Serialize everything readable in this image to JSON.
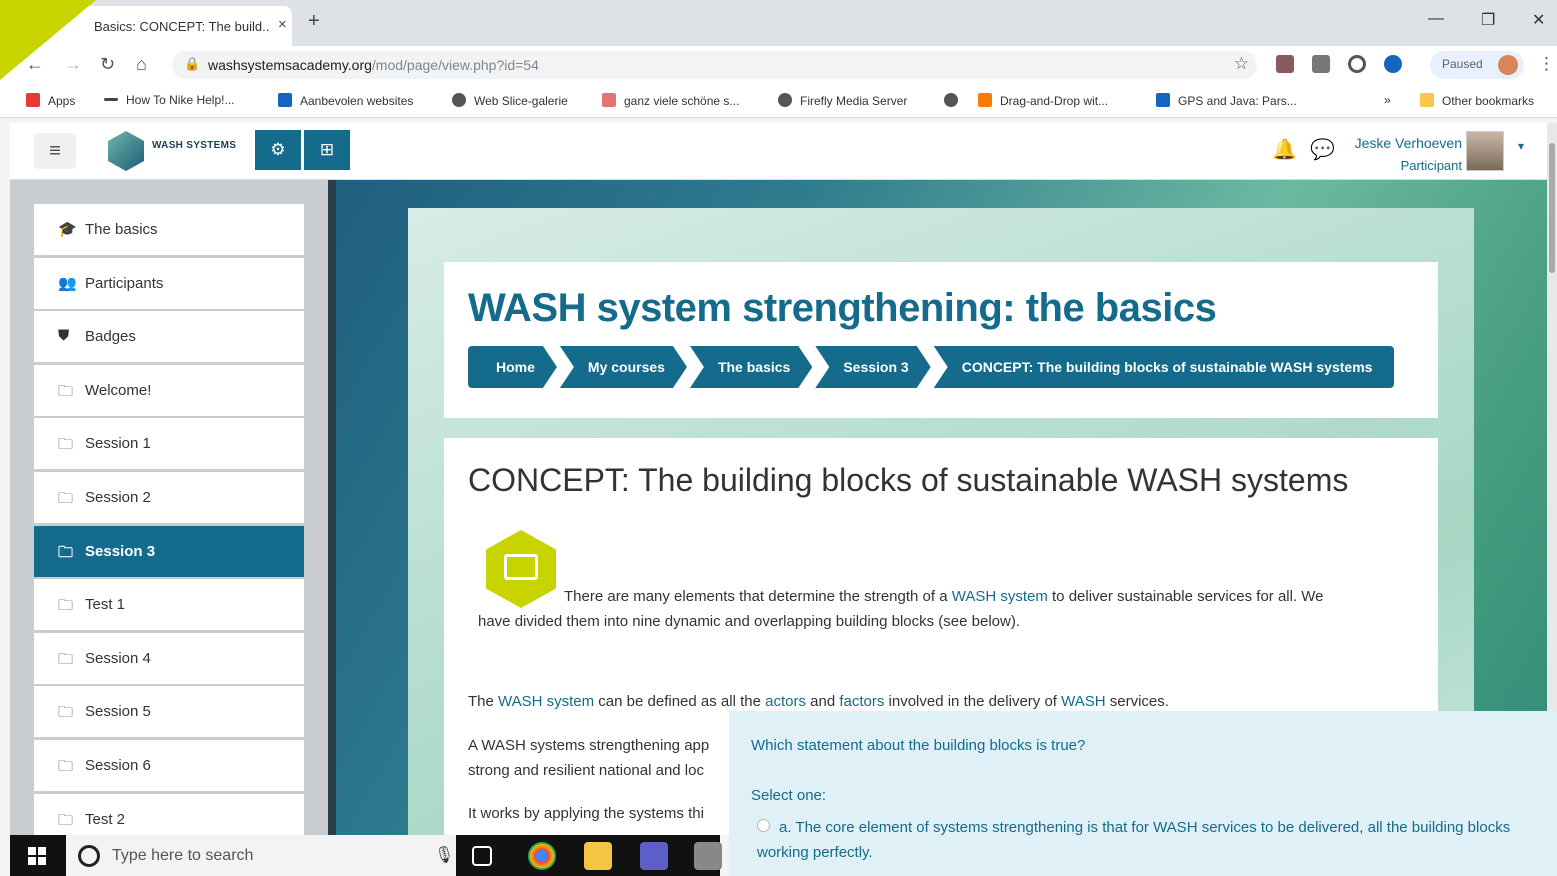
{
  "browser": {
    "tab_title": "Basics: CONCEPT: The build...",
    "tab_close": "×",
    "new_tab": "+",
    "url_host": "washsystemsacademy.org",
    "url_path": "/mod/page/view.php?id=54",
    "paused_label": "Paused",
    "bookmarks": [
      "Apps",
      "How To Nike Help!...",
      "Aanbevolen websites",
      "Web Slice-galerie",
      "ganz viele schöne s...",
      "Firefly Media Server",
      "Drag-and-Drop wit...",
      "GPS and Java: Pars...",
      "»",
      "Other bookmarks"
    ]
  },
  "header": {
    "logo_text": "WASH SYSTEMS",
    "user_name": "Jeske Verhoeven",
    "user_role": "Participant"
  },
  "sidebar": {
    "items": [
      {
        "icon": "graduation-cap-icon",
        "glyph": "🎓",
        "label": "The basics"
      },
      {
        "icon": "users-icon",
        "glyph": "👥",
        "label": "Participants"
      },
      {
        "icon": "shield-icon",
        "glyph": "⛊",
        "label": "Badges"
      },
      {
        "icon": "folder-icon",
        "glyph": "🗀",
        "label": "Welcome!"
      },
      {
        "icon": "folder-icon",
        "glyph": "🗀",
        "label": "Session 1"
      },
      {
        "icon": "folder-icon",
        "glyph": "🗀",
        "label": "Session 2"
      },
      {
        "icon": "folder-icon",
        "glyph": "🗀",
        "label": "Session 3",
        "active": true
      },
      {
        "icon": "folder-icon",
        "glyph": "🗀",
        "label": "Test 1"
      },
      {
        "icon": "folder-icon",
        "glyph": "🗀",
        "label": "Session 4"
      },
      {
        "icon": "folder-icon",
        "glyph": "🗀",
        "label": "Session 5"
      },
      {
        "icon": "folder-icon",
        "glyph": "🗀",
        "label": "Session 6"
      },
      {
        "icon": "folder-icon",
        "glyph": "🗀",
        "label": "Test 2"
      }
    ]
  },
  "main": {
    "page_title": "WASH system strengthening: the basics",
    "breadcrumbs": [
      "Home",
      "My courses",
      "The basics",
      "Session 3",
      "CONCEPT: The building blocks of sustainable WASH systems"
    ],
    "heading": "CONCEPT: The building blocks of sustainable WASH systems",
    "para1_a": "There are many elements that determine the strength of a ",
    "para1_link": "WASH system",
    "para1_b": " to deliver sustainable services for all. We",
    "para1_c": "have divided them into nine dynamic and overlapping building blocks (see below).",
    "para2_a": "The ",
    "para2_link1": "WASH system",
    "para2_b": " can be defined as all the ",
    "para2_link2": "actors",
    "para2_c": " and ",
    "para2_link3": "factors",
    "para2_d": " involved in the delivery of ",
    "para2_link4": "WASH",
    "para2_e": " services.",
    "para3_a": "A WASH systems strengthening app",
    "para3_b": "strong and resilient national and loc",
    "para4": "It works by applying the systems thi"
  },
  "quiz": {
    "question": "Which statement about the building blocks is true?",
    "select_label": "Select one:",
    "option_a_1": "a. The core element of systems strengthening is that for ",
    "option_a_link": "WASH",
    "option_a_2": " services to be delivered, all the building blocks",
    "option_a_3": "working perfectly."
  },
  "taskbar": {
    "search_text": "Type here to search"
  },
  "colors": {
    "brand": "#146b8b",
    "accent": "#c8d400",
    "notification": "#c62828"
  }
}
